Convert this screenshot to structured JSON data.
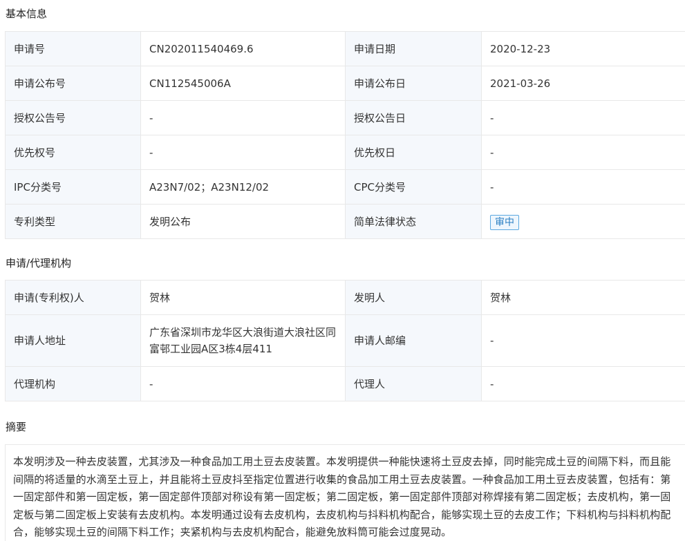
{
  "sections": {
    "basic": "基本信息",
    "agent": "申请/代理机构",
    "abstract": "摘要"
  },
  "basic_rows": [
    {
      "k1": "申请号",
      "v1": "CN202011540469.6",
      "k2": "申请日期",
      "v2": "2020-12-23"
    },
    {
      "k1": "申请公布号",
      "v1": "CN112545006A",
      "k2": "申请公布日",
      "v2": "2021-03-26"
    },
    {
      "k1": "授权公告号",
      "v1": "-",
      "k2": "授权公告日",
      "v2": "-"
    },
    {
      "k1": "优先权号",
      "v1": "-",
      "k2": "优先权日",
      "v2": "-"
    },
    {
      "k1": "IPC分类号",
      "v1": "A23N7/02；A23N12/02",
      "k2": "CPC分类号",
      "v2": "-"
    },
    {
      "k1": "专利类型",
      "v1": "发明公布",
      "k2": "简单法律状态",
      "badge": "审中"
    }
  ],
  "agent_rows": [
    {
      "k1": "申请(专利权)人",
      "v1": "贺林",
      "k2": "发明人",
      "v2": "贺林"
    },
    {
      "k1": "申请人地址",
      "v1": "广东省深圳市龙华区大浪街道大浪社区同富邨工业园A区3栋4层411",
      "k2": "申请人邮编",
      "v2": "-"
    },
    {
      "k1": "代理机构",
      "v1": "-",
      "k2": "代理人",
      "v2": "-"
    }
  ],
  "abstract": "本发明涉及一种去皮装置，尤其涉及一种食品加工用土豆去皮装置。本发明提供一种能快速将土豆皮去掉，同时能完成土豆的间隔下料，而且能间隔的将适量的水滴至土豆上，并且能将土豆皮抖至指定位置进行收集的食品加工用土豆去皮装置。一种食品加工用土豆去皮装置，包括有：第一固定部件和第一固定板，第一固定部件顶部对称设有第一固定板；第二固定板，第一固定部件顶部对称焊接有第二固定板；去皮机构，第一固定板与第二固定板上安装有去皮机构。本发明通过设有去皮机构，去皮机构与抖料机构配合，能够实现土豆的去皮工作；下料机构与抖料机构配合，能够实现土豆的间隔下料工作；夹紧机构与去皮机构配合，能避免放料筒可能会过度晃动。"
}
